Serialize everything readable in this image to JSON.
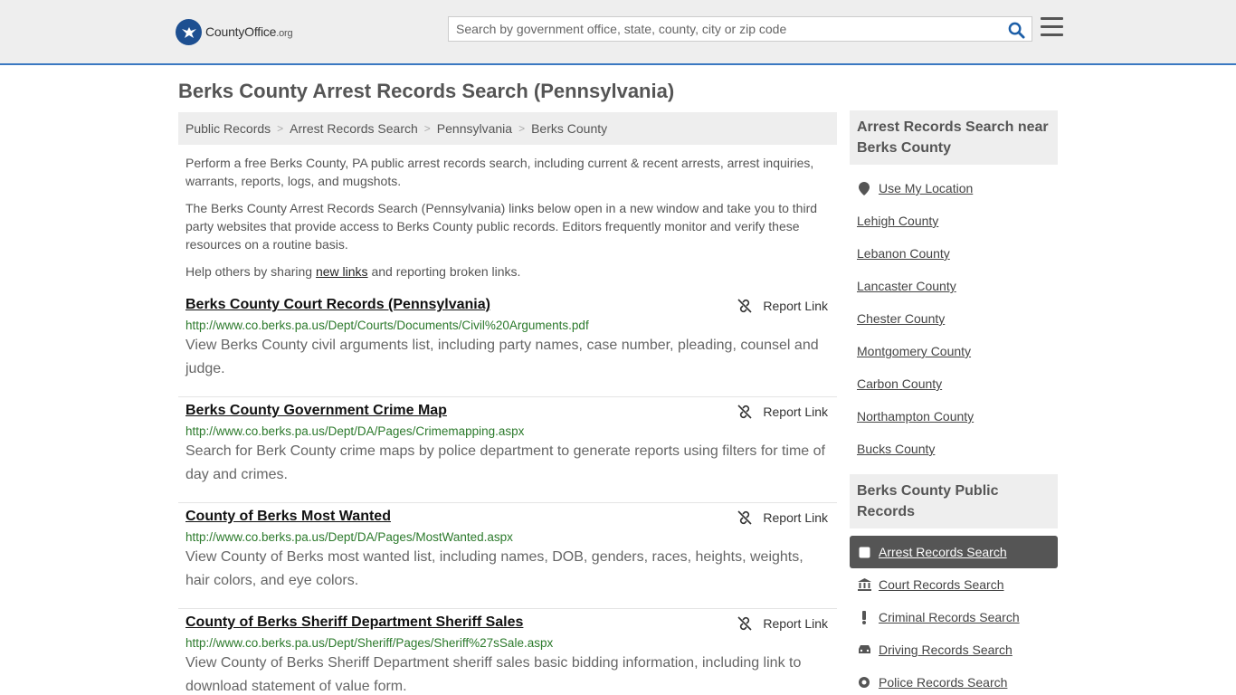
{
  "header": {
    "logo_main": "CountyOffice",
    "logo_suffix": ".org",
    "search_placeholder": "Search by government office, state, county, city or zip code"
  },
  "page_title": "Berks County Arrest Records Search (Pennsylvania)",
  "breadcrumb": [
    "Public Records",
    "Arrest Records Search",
    "Pennsylvania",
    "Berks County"
  ],
  "intro": {
    "p1": "Perform a free Berks County, PA public arrest records search, including current & recent arrests, arrest inquiries, warrants, reports, logs, and mugshots.",
    "p2": "The Berks County Arrest Records Search (Pennsylvania) links below open in a new window and take you to third party websites that provide access to Berks County public records. Editors frequently monitor and verify these resources on a routine basis.",
    "p3_before": "Help others by sharing ",
    "p3_link": "new links",
    "p3_after": " and reporting broken links."
  },
  "report_label": "Report Link",
  "results": [
    {
      "title": "Berks County Court Records (Pennsylvania)",
      "url": "http://www.co.berks.pa.us/Dept/Courts/Documents/Civil%20Arguments.pdf",
      "desc": "View Berks County civil arguments list, including party names, case number, pleading, counsel and judge."
    },
    {
      "title": "Berks County Government Crime Map",
      "url": "http://www.co.berks.pa.us/Dept/DA/Pages/Crimemapping.aspx",
      "desc": "Search for Berk County crime maps by police department to generate reports using filters for time of day and crimes."
    },
    {
      "title": "County of Berks Most Wanted",
      "url": "http://www.co.berks.pa.us/Dept/DA/Pages/MostWanted.aspx",
      "desc": "View County of Berks most wanted list, including names, DOB, genders, races, heights, weights, hair colors, and eye colors."
    },
    {
      "title": "County of Berks Sheriff Department Sheriff Sales",
      "url": "http://www.co.berks.pa.us/Dept/Sheriff/Pages/Sheriff%27sSale.aspx",
      "desc": "View County of Berks Sheriff Department sheriff sales basic bidding information, including link to download statement of value form."
    }
  ],
  "sidebar": {
    "nearby_title": "Arrest Records Search near Berks County",
    "use_location": "Use My Location",
    "nearby": [
      "Lehigh County",
      "Lebanon County",
      "Lancaster County",
      "Chester County",
      "Montgomery County",
      "Carbon County",
      "Northampton County",
      "Bucks County"
    ],
    "records_title": "Berks County Public Records",
    "records": [
      {
        "label": "Arrest Records Search",
        "icon": "square-icon",
        "active": true
      },
      {
        "label": "Court Records Search",
        "icon": "courthouse-icon",
        "active": false
      },
      {
        "label": "Criminal Records Search",
        "icon": "exclamation-icon",
        "active": false
      },
      {
        "label": "Driving Records Search",
        "icon": "car-icon",
        "active": false
      },
      {
        "label": "Police Records Search",
        "icon": "badge-icon",
        "active": false
      }
    ]
  },
  "colors": {
    "accent": "#3a78c1",
    "url_green": "#2c7a2c",
    "active_bg": "#555555"
  }
}
